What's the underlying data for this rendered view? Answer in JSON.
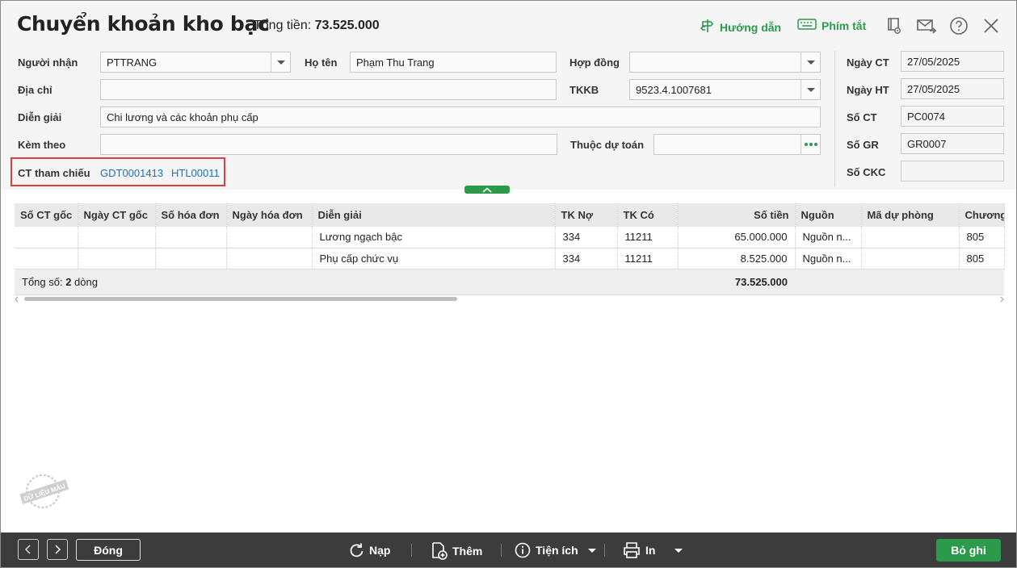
{
  "header": {
    "title": "Chuyển khoản kho bạc",
    "total_label": "Tổng tiền:",
    "total_value": "73.525.000",
    "guide_label": "Hướng dẫn",
    "shortcut_label": "Phím tắt"
  },
  "form": {
    "nguoi_nhan_label": "Người nhận",
    "nguoi_nhan_value": "PTTRANG",
    "ho_ten_label": "Họ tên",
    "ho_ten_value": "Phạm Thu Trang",
    "hop_dong_label": "Hợp đồng",
    "hop_dong_value": "",
    "dia_chi_label": "Địa chỉ",
    "dia_chi_value": "",
    "tkkb_label": "TKKB",
    "tkkb_value": "9523.4.1007681",
    "dien_giai_label": "Diễn giải",
    "dien_giai_value": "Chi lương và các khoản phụ cấp",
    "kem_theo_label": "Kèm theo",
    "kem_theo_value": "",
    "thuoc_du_toan_label": "Thuộc dự toán",
    "thuoc_du_toan_value": "",
    "ct_tham_chieu_label": "CT tham chiếu",
    "ct_tham_chieu_links": [
      "GDT0001413",
      "HTL00011"
    ]
  },
  "side": {
    "ngay_ct_label": "Ngày CT",
    "ngay_ct_value": "27/05/2025",
    "ngay_ht_label": "Ngày HT",
    "ngay_ht_value": "27/05/2025",
    "so_ct_label": "Số CT",
    "so_ct_value": "PC0074",
    "so_gr_label": "Số GR",
    "so_gr_value": "GR0007",
    "so_ckc_label": "Số CKC",
    "so_ckc_value": ""
  },
  "grid": {
    "columns": [
      "Số CT gốc",
      "Ngày CT gốc",
      "Số hóa đơn",
      "Ngày hóa đơn",
      "Diễn giải",
      "TK Nợ",
      "TK Có",
      "Số tiền",
      "Nguồn",
      "Mã dự phòng",
      "Chương"
    ],
    "rows": [
      [
        "",
        "",
        "",
        "",
        "Lương ngạch bậc",
        "334",
        "11211",
        "65.000.000",
        "Nguồn n...",
        "",
        "805"
      ],
      [
        "",
        "",
        "",
        "",
        "Phụ cấp chức vụ",
        "334",
        "11211",
        "8.525.000",
        "Nguồn n...",
        "",
        "805"
      ]
    ],
    "footer_prefix": "Tổng số: ",
    "footer_count": "2",
    "footer_suffix": " dòng",
    "footer_total": "73.525.000"
  },
  "stamp_text": "DỮ LIỆU MẪU",
  "toolbar": {
    "close_label": "Đóng",
    "reload_label": "Nạp",
    "add_label": "Thêm",
    "utility_label": "Tiện ích",
    "print_label": "In",
    "save_label": "Bỏ ghi"
  },
  "colors": {
    "accent": "#2b9a4a",
    "link": "#1a6fc4",
    "highlight": "#e13c3c",
    "bottom_bar": "#3c3c3c"
  }
}
